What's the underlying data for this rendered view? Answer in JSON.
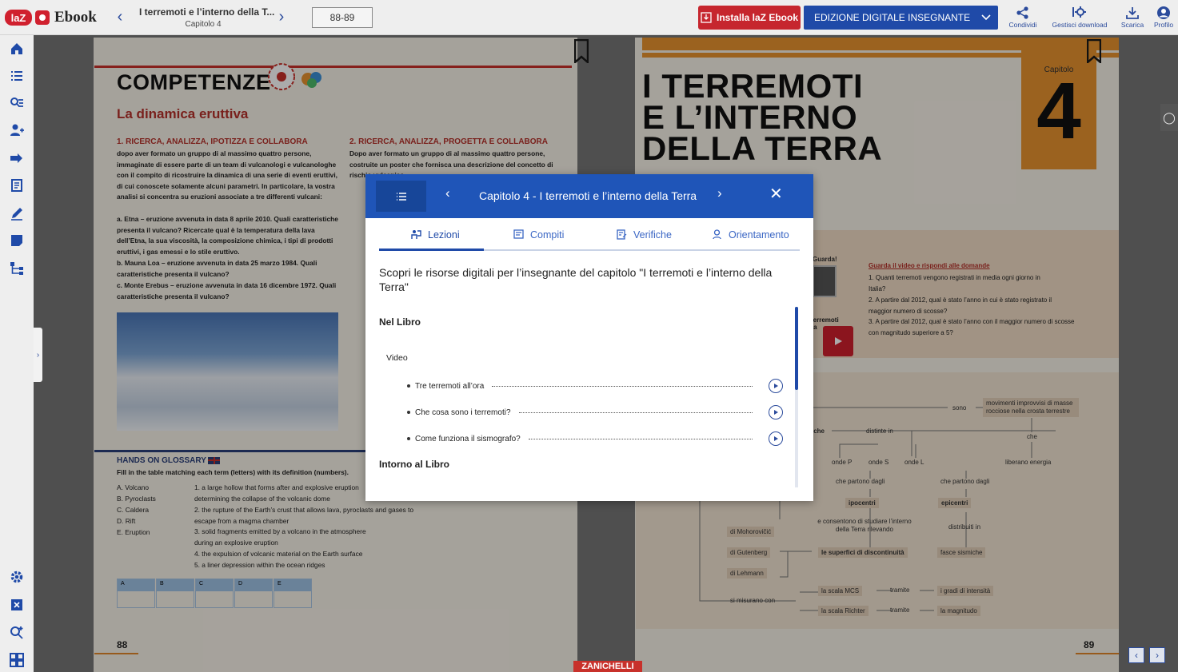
{
  "topbar": {
    "logo_laz": "laZ",
    "logo_text": "Ebook",
    "doc_title": "I terremoti e l’interno della T...",
    "doc_subtitle": "Capitolo 4",
    "page_range": "88-89",
    "install_label": "Installa laZ Ebook",
    "edition_label": "EDIZIONE DIGITALE INSEGNANTE",
    "tools": [
      {
        "label": "Condividi",
        "icon": "share-icon"
      },
      {
        "label": "Gestisci download",
        "icon": "manage-download-icon"
      },
      {
        "label": "Scarica",
        "icon": "download-icon"
      },
      {
        "label": "Profilo",
        "icon": "profile-icon"
      }
    ]
  },
  "sidebar": {
    "icons": [
      "home-icon",
      "list-icon",
      "search-list-icon",
      "user-add-icon",
      "arrow-tag-icon",
      "document-icon",
      "pen-icon",
      "note-icon",
      "tree-icon",
      "settings-icon",
      "zoom-icon",
      "zoom-plus-icon",
      "grid-icon"
    ]
  },
  "left_page": {
    "heading": "COMPETENZE",
    "subheading": "La dinamica eruttiva",
    "section1_title": "1. RICERCA, ANALIZZA, IPOTIZZA E COLLABORA",
    "section1_text": "dopo aver formato un gruppo di al massimo quattro persone, immaginate di essere parte di un team di vulcanologi e vulcanologhe con il compito di ricostruire la dinamica di una serie di eventi eruttivi, di cui conoscete solamente alcuni parametri. In particolare, la vostra analisi si concentra su eruzioni associate a tre differenti vulcani:",
    "section1_items": [
      "a. Etna – eruzione avvenuta in data 8 aprile 2010. Quali caratteristiche presenta il vulcano? Ricercate qual è la temperatura della lava dell’Etna, la sua viscosità, la composizione chimica, i tipi di prodotti eruttivi, i gas emessi e lo stile eruttivo.",
      "b. Mauna Loa – eruzione avvenuta in data 25 marzo 1984. Quali caratteristiche presenta il vulcano?",
      "c. Monte Erebus – eruzione avvenuta in data 16 dicembre 1972. Quali caratteristiche presenta il vulcano?"
    ],
    "section2_title": "2. RICERCA, ANALIZZA, PROGETTA E COLLABORA",
    "section2_text": "Dopo aver formato un gruppo di al massimo quattro persone, costruite un poster che fornisca una descrizione del concetto di rischio vulcanico",
    "glossary_title": "HANDS ON GLOSSARY",
    "glossary_instr": "Fill in the table matching each term (letters) with its definition (numbers).",
    "glossary_terms": [
      "A. Volcano",
      "B. Pyroclasts",
      "C. Caldera",
      "D. Rift",
      "E. Eruption"
    ],
    "glossary_defs": [
      "1. a large hollow that forms after and explosive eruption determining the collapse of the volcanic dome",
      "2. the rupture of the Earth’s crust that allows lava, pyroclasts and gases to escape from a magma chamber",
      "3. solid fragments emitted by a volcano in the atmosphere during an explosive eruption",
      "4. the expulsion of volcanic material on the Earth surface",
      "5. a liner depression within the ocean ridges"
    ],
    "table_headers": [
      "A",
      "B",
      "C",
      "D",
      "E"
    ],
    "page_number": "88"
  },
  "right_page": {
    "chapter_title_l1": "I TERREMOTI",
    "chapter_title_l2": "E L’INTERNO",
    "chapter_title_l3": "DELLA TERRA",
    "chapter_label": "Capitolo",
    "chapter_number": "4",
    "video_heading": "Guarda il video e rispondi alle domande",
    "video_questions": [
      "1. Quanti terremoti vengono registrati in media ogni giorno in Italia?",
      "2. A partire dal 2012, qual è stato l’anno in cui è stato registrato il maggior numero di scosse?",
      "3. A partire dal 2012, qual è stato l’anno con il maggior numero di scosse con magnitudo superiore a 5?"
    ],
    "video_label": "Guarda!",
    "video_caption": "terremoti ra",
    "concept": {
      "sono": "sono",
      "movimenti": "movimenti improvvisi di masse rocciose nella crosta terrestre",
      "che": "che",
      "liberano": "liberano energia",
      "distinte": "distinte in",
      "iche": "iche",
      "onde_p": "onde P",
      "onde_s": "onde S",
      "onde_l": "onde L",
      "partono1": "che partono dagli",
      "partono2": "che partono dagli",
      "ipocentri": "ipocentri",
      "epicentri": "epicentri",
      "consentono": "e consentono di studiare l’interno della Terra rilevando",
      "distribuiti": "distribuiti in",
      "mohorovicic": "di Mohorovičić",
      "gutenberg": "di Gutenberg",
      "lehmann": "di Lehmann",
      "superfici": "le superfici di discontinuità",
      "fasce": "fasce sismiche",
      "misurano": "si misurano con",
      "mcs": "la scala MCS",
      "richter": "la scala Richter",
      "tramite1": "tramite",
      "tramite2": "tramite",
      "gradi": "i gradi di intensità",
      "magnitudo": "la magnitudo"
    },
    "page_number": "89"
  },
  "publisher": "ZANICHELLI",
  "modal": {
    "title": "Capitolo 4 - I terremoti e l’interno della Terra",
    "tabs": [
      {
        "label": "Lezioni",
        "icon": "lessons-icon",
        "active": true
      },
      {
        "label": "Compiti",
        "icon": "tasks-icon",
        "active": false
      },
      {
        "label": "Verifiche",
        "icon": "tests-icon",
        "active": false
      },
      {
        "label": "Orientamento",
        "icon": "orientation-icon",
        "active": false
      }
    ],
    "intro": "Scopri le risorse digitali per l’insegnante del capitolo \"I terremoti e l’interno della Terra\"",
    "section_book": "Nel Libro",
    "subsection_video": "Video",
    "videos": [
      "Tre terremoti all’ora",
      "Che cosa sono i terremoti?",
      "Come funziona il sismografo?"
    ],
    "section_around": "Intorno al Libro"
  },
  "colors": {
    "accent_blue": "#1f4aa8",
    "install_red": "#c6262e",
    "chapter_orange": "#e8922f"
  }
}
